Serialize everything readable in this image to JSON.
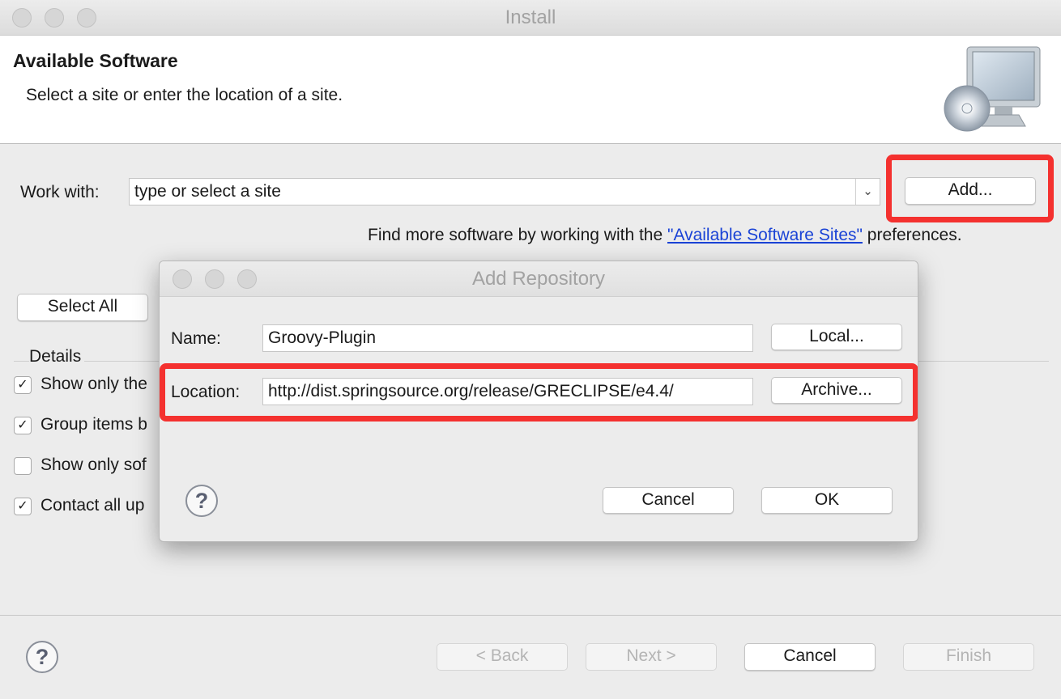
{
  "window": {
    "title": "Install"
  },
  "header": {
    "title": "Available Software",
    "subtitle": "Select a site or enter the location of a site.",
    "icon": "install-software-monitor-cd-icon"
  },
  "work_with": {
    "label": "Work with:",
    "placeholder": "type or select a site",
    "add_button": "Add..."
  },
  "find_more": {
    "prefix": "Find more software by working with the ",
    "link": "\"Available Software Sites\"",
    "suffix": " preferences."
  },
  "select_all_button": "Select All",
  "details": {
    "legend": "Details",
    "options": [
      {
        "label": "Show only the",
        "checked": true
      },
      {
        "label": "Group items b",
        "checked": true
      },
      {
        "label": "Show only sof",
        "checked": false
      },
      {
        "label": "Contact all up",
        "checked": true
      }
    ]
  },
  "footer": {
    "back": "< Back",
    "next": "Next >",
    "cancel": "Cancel",
    "finish": "Finish"
  },
  "dialog": {
    "title": "Add Repository",
    "name_label": "Name:",
    "name_value": "Groovy-Plugin",
    "local_button": "Local...",
    "location_label": "Location:",
    "location_value": "http://dist.springsource.org/release/GRECLIPSE/e4.4/",
    "archive_button": "Archive...",
    "cancel": "Cancel",
    "ok": "OK"
  },
  "colors": {
    "highlight": "#f4312f",
    "link": "#1a43d6"
  }
}
